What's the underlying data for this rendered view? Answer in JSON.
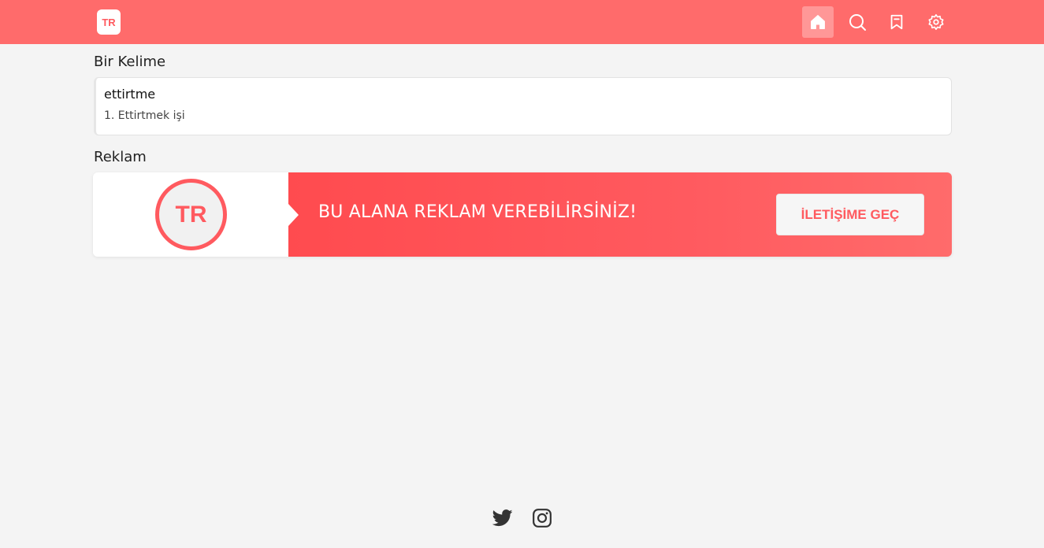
{
  "header": {
    "logo_text": "TR",
    "nav": [
      {
        "name": "home",
        "icon": "home-icon",
        "active": true
      },
      {
        "name": "search",
        "icon": "search-icon",
        "active": false
      },
      {
        "name": "bookmarks",
        "icon": "bookmark-icon",
        "active": false
      },
      {
        "name": "settings",
        "icon": "gear-icon",
        "active": false
      }
    ],
    "accent_color": "#ff6b6b"
  },
  "word_section": {
    "title": "Bir Kelime",
    "word": "ettirtme",
    "definition": "1. Ettirtmek işi"
  },
  "ad_section": {
    "title": "Reklam",
    "logo_text": "TR",
    "banner_text": "BU ALANA REKLAM VEREBİLİRSİNİZ!",
    "cta_label": "İLETİŞİME GEÇ"
  },
  "footer": {
    "icons": [
      "twitter-icon",
      "instagram-icon"
    ]
  }
}
